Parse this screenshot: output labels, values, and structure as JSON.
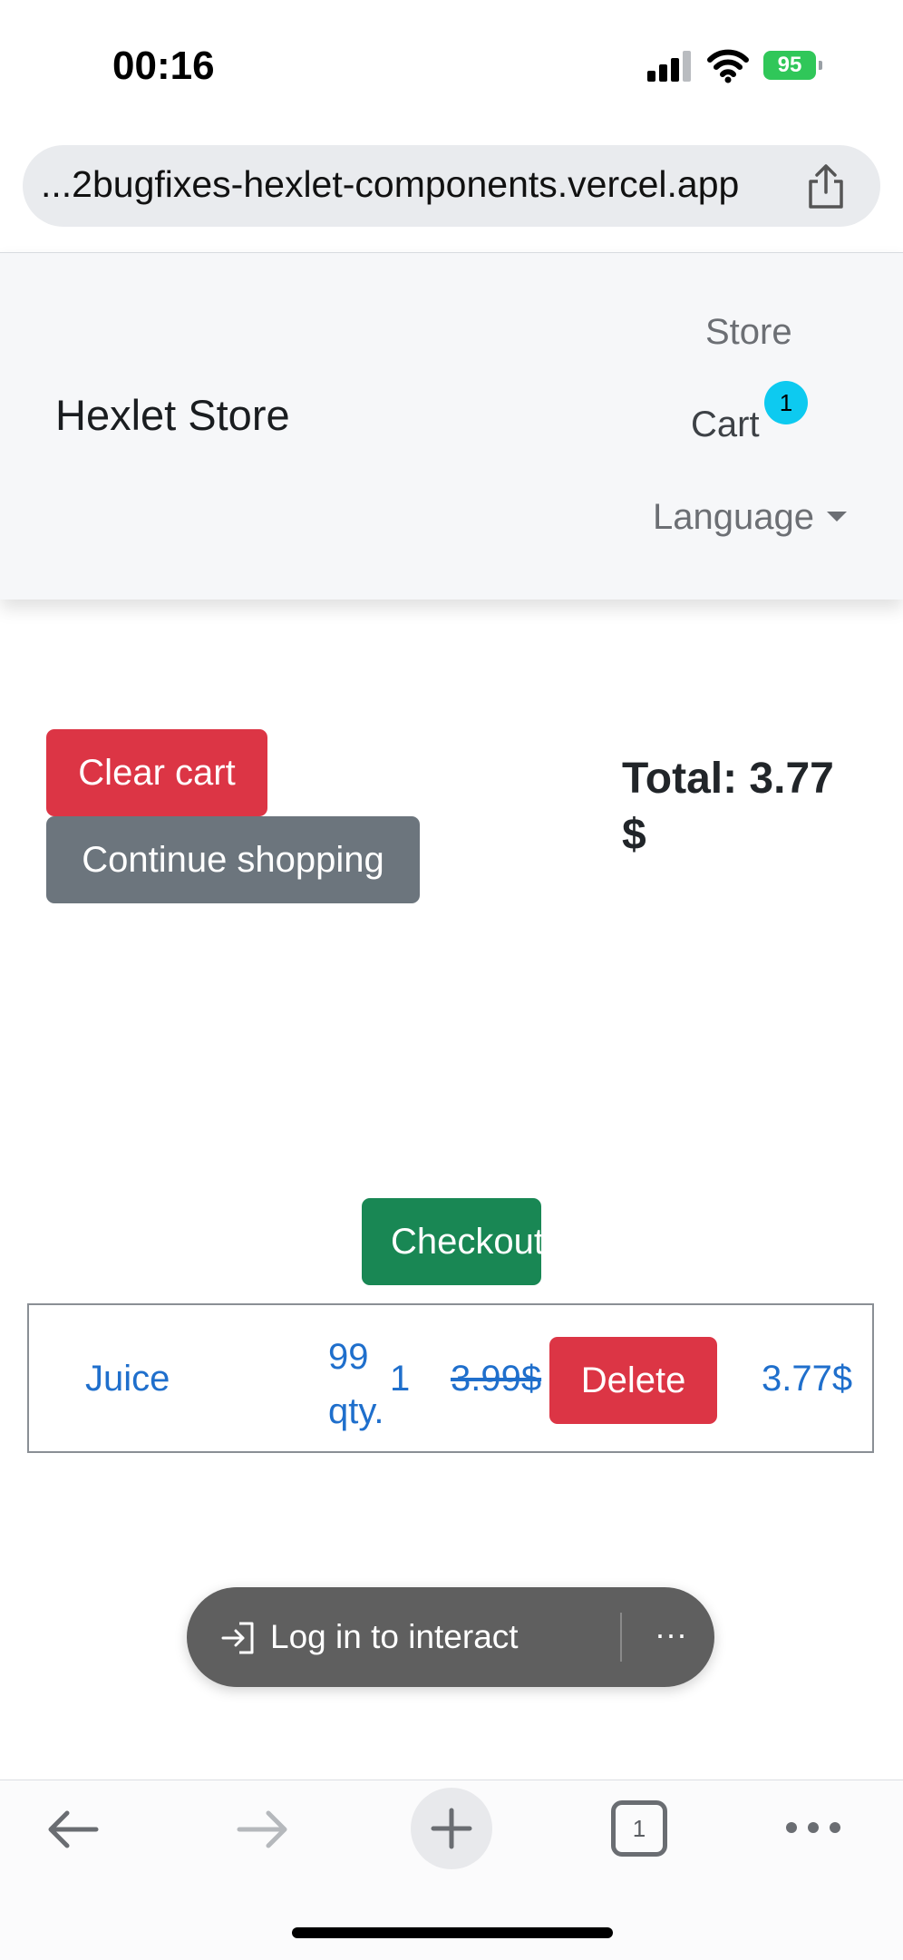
{
  "status_bar": {
    "time": "00:16",
    "battery": "95"
  },
  "browser": {
    "url": "...2bugfixes-hexlet-components.vercel.app",
    "tab_count": "1"
  },
  "navbar": {
    "brand": "Hexlet Store",
    "store_link": "Store",
    "cart_link": "Cart",
    "cart_count": "1",
    "language_dropdown": "Language"
  },
  "actions": {
    "clear_cart": "Clear cart",
    "continue_shopping": "Continue shopping",
    "checkout": "Checkout"
  },
  "summary": {
    "total": "Total: 3.77 $"
  },
  "cart_items": [
    {
      "name": "Juice",
      "unit": "99 qty.",
      "quantity": "1",
      "old_price": "3.99$",
      "delete_label": "Delete",
      "price": "3.77$"
    }
  ],
  "overlay": {
    "login_prompt": "Log in to interact",
    "more": "···"
  },
  "colors": {
    "danger": "#dc3545",
    "secondary": "#6c757d",
    "success": "#198754",
    "link": "#1f6fcc",
    "badge": "#0dcaf0"
  }
}
